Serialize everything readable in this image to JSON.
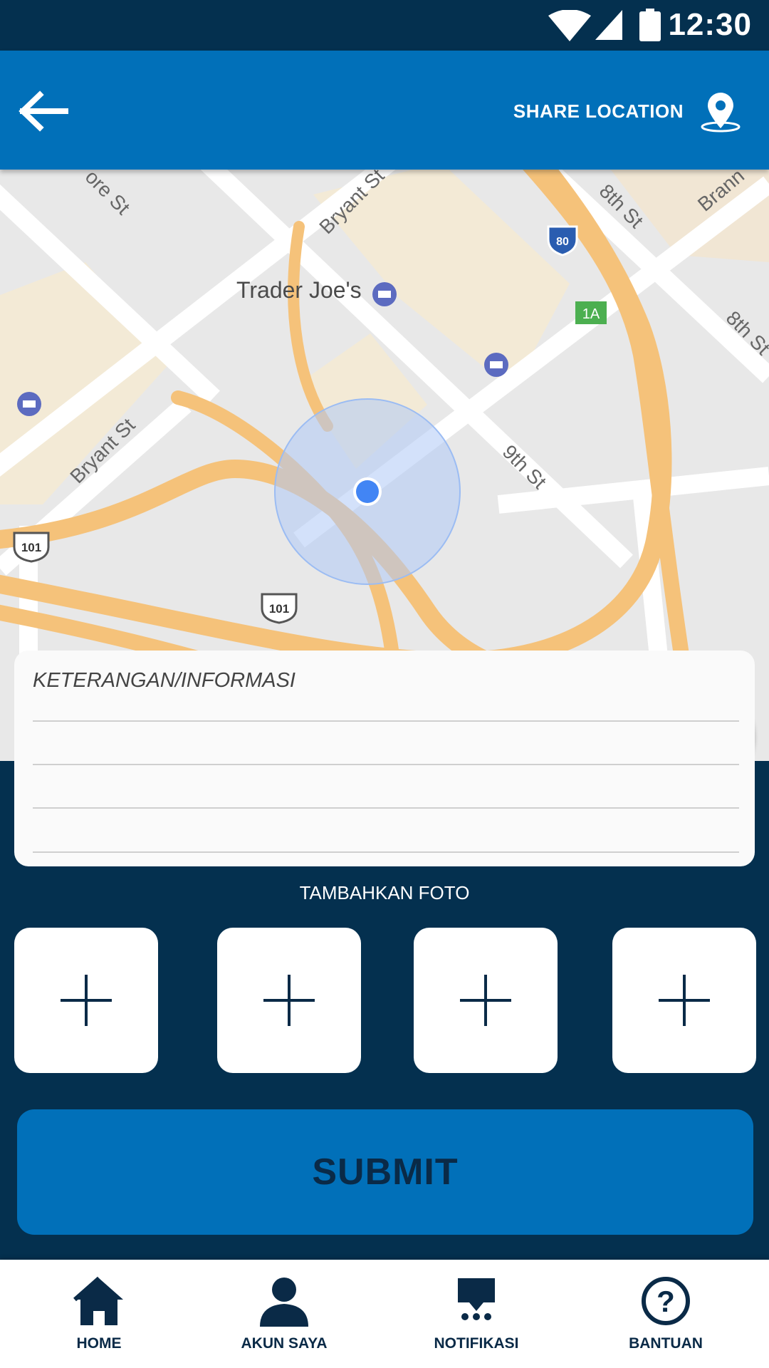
{
  "status_bar": {
    "time": "12:30"
  },
  "app_bar": {
    "share_location_label": "SHARE LOCATION"
  },
  "map": {
    "labels": {
      "trader_joes": "Trader Joe's",
      "bryant_st_top": "Bryant St",
      "bryant_st_left": "Bryant St",
      "ninth_st": "9th St",
      "eighth_st_top": "8th St",
      "eighth_st_right": "8th St",
      "moore_st": "ore St",
      "brann": "Brann",
      "i80_shield": "80",
      "exit_1a": "1A",
      "us101_left": "101",
      "us101_center": "101"
    }
  },
  "info": {
    "label": "KETERANGAN/INFORMASI"
  },
  "photos": {
    "title": "TAMBAHKAN FOTO"
  },
  "submit": {
    "label": "SUBMIT"
  },
  "bottom_nav": {
    "items": [
      {
        "label": "HOME",
        "icon": "home-icon"
      },
      {
        "label": "AKUN SAYA",
        "icon": "account-icon"
      },
      {
        "label": "NOTIFIKASI",
        "icon": "notification-icon"
      },
      {
        "label": "BANTUAN",
        "icon": "help-icon"
      }
    ]
  },
  "colors": {
    "primary": "#0170b9",
    "dark_navy": "#04304f",
    "text_navy": "#0a2a47",
    "location_blue": "#4285f4"
  }
}
